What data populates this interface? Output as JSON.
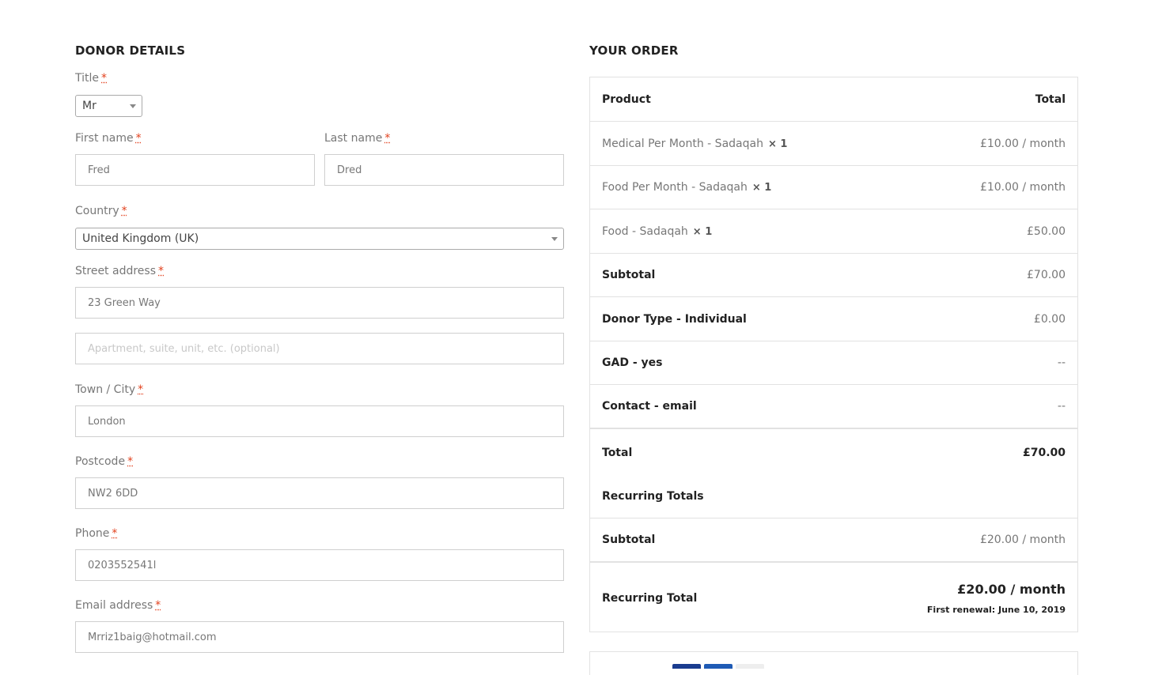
{
  "donor": {
    "heading": "DONOR DETAILS",
    "required_mark": "*",
    "title_label": "Title",
    "title_value": "Mr",
    "first_name_label": "First name",
    "first_name_value": "Fred",
    "last_name_label": "Last name",
    "last_name_value": "Dred",
    "country_label": "Country",
    "country_value": "United Kingdom (UK)",
    "street_label": "Street address",
    "street_value": "23 Green Way",
    "apartment_placeholder": "Apartment, suite, unit, etc. (optional)",
    "city_label": "Town / City",
    "city_value": "London",
    "postcode_label": "Postcode",
    "postcode_value": "NW2 6DD",
    "phone_label": "Phone",
    "phone_value": "0203552541l",
    "email_label": "Email address",
    "email_value": "Mrriz1baig@hotmail.com"
  },
  "order": {
    "heading": "YOUR ORDER",
    "col_product": "Product",
    "col_total": "Total",
    "items": [
      {
        "name": "Medical Per Month - Sadaqah",
        "qty": "× 1",
        "total": "£10.00 / month"
      },
      {
        "name": "Food Per Month - Sadaqah",
        "qty": "× 1",
        "total": "£10.00 / month"
      },
      {
        "name": "Food - Sadaqah",
        "qty": "× 1",
        "total": "£50.00"
      }
    ],
    "subtotal_label": "Subtotal",
    "subtotal_value": "£70.00",
    "donor_type_label": "Donor Type - Individual",
    "donor_type_value": "£0.00",
    "gad_label": "GAD - yes",
    "gad_value": "--",
    "contact_label": "Contact - email",
    "contact_value": "--",
    "total_label": "Total",
    "total_value": "£70.00",
    "recurring_heading": "Recurring Totals",
    "recurring_subtotal_label": "Subtotal",
    "recurring_subtotal_value": "£20.00 / month",
    "recurring_total_label": "Recurring Total",
    "recurring_total_value": "£20.00 / month",
    "first_renewal": "First renewal: June 10, 2019"
  }
}
